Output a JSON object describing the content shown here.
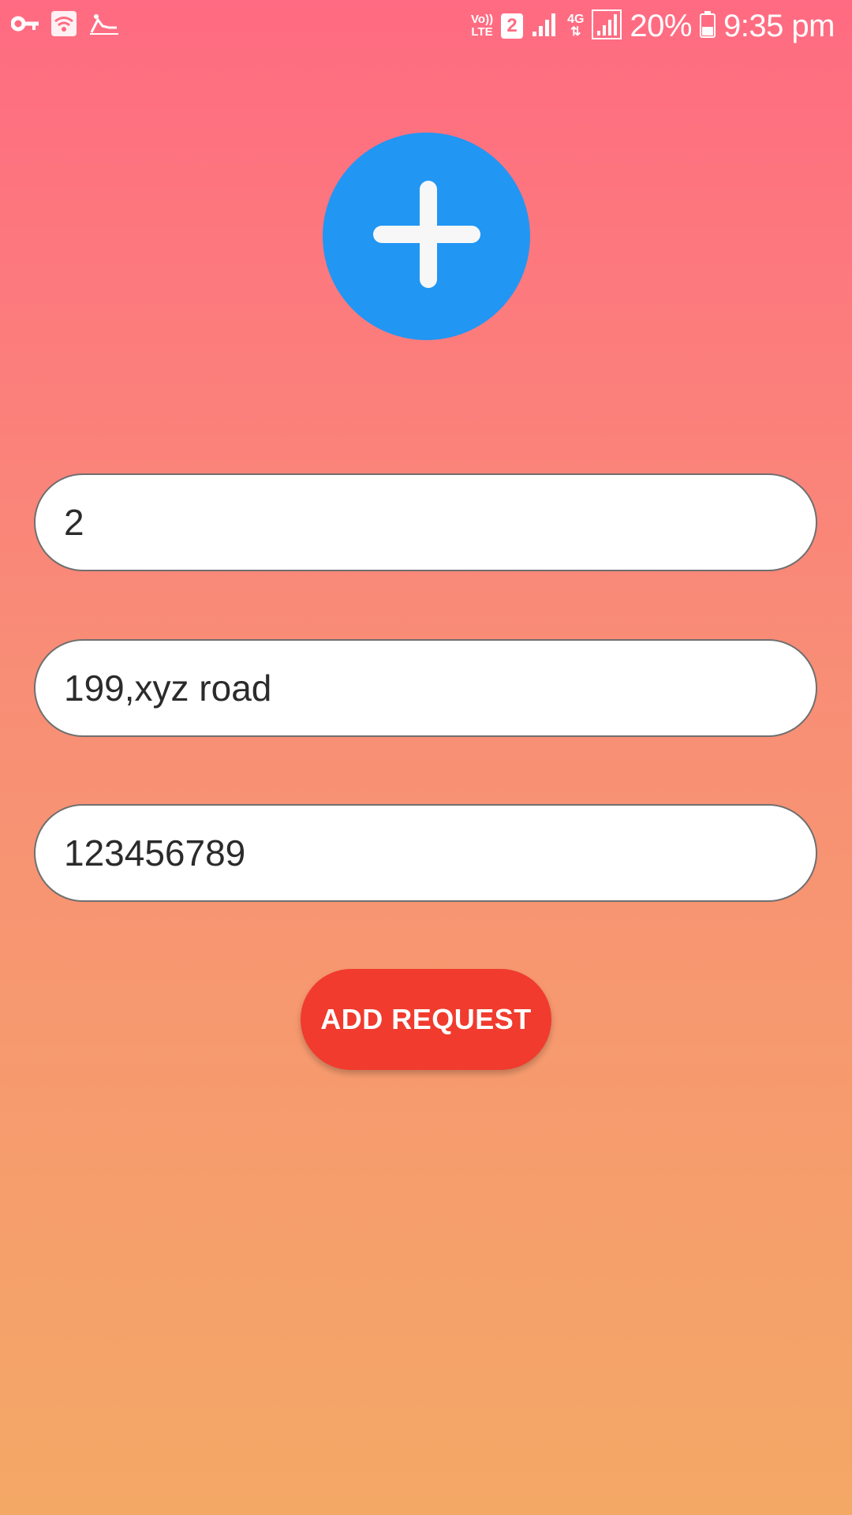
{
  "status_bar": {
    "left_icons": [
      "key-icon",
      "wifi-hotspot-icon",
      "sleeping-icon"
    ],
    "volte_label": "Vo))\nLTE",
    "sim_slot": "2",
    "network_type": "4G",
    "battery_percent": "20%",
    "time": "9:35 pm"
  },
  "add_image": {
    "icon": "plus-icon",
    "color": "#2196f3"
  },
  "form": {
    "field1_value": "2",
    "field2_value": "199,xyz road",
    "field3_value": "123456789"
  },
  "actions": {
    "add_request_label": "ADD REQUEST",
    "button_color": "#f03b2e"
  },
  "theme": {
    "gradient_top": "#ff6b82",
    "gradient_bottom": "#f4a866"
  }
}
